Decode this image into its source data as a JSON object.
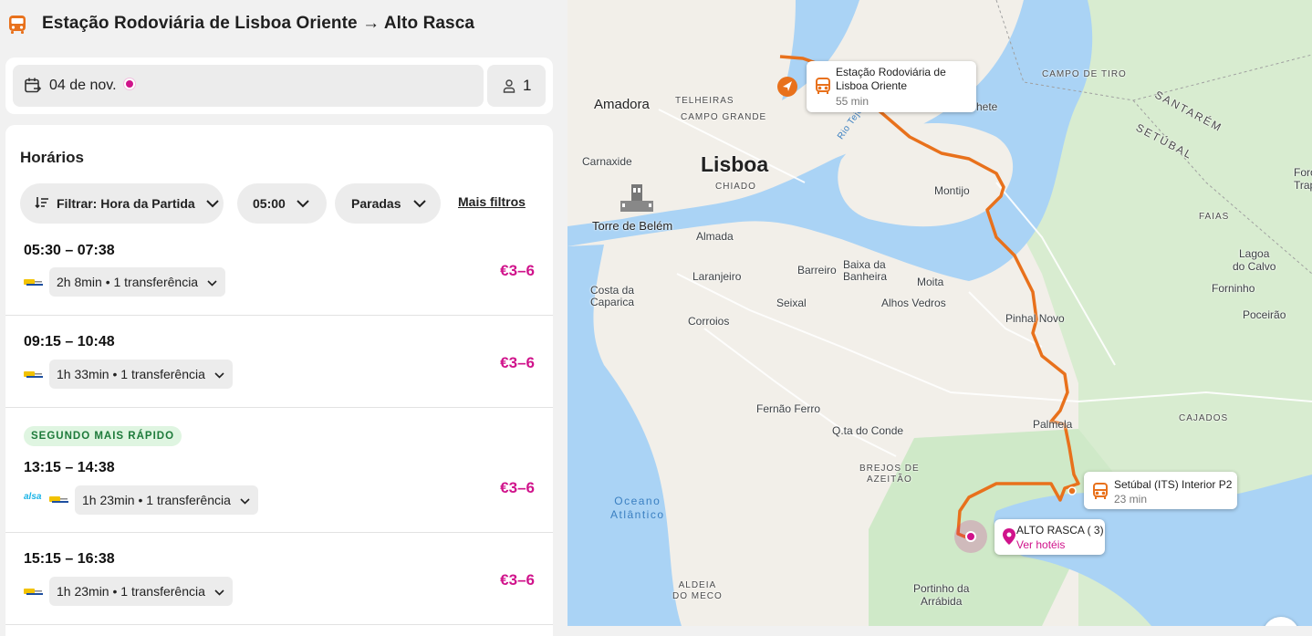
{
  "header": {
    "title": "Estação Rodoviária de Lisboa Oriente → Alto Rasca"
  },
  "search": {
    "date": "04 de nov.",
    "passengers": "1"
  },
  "results": {
    "section_title": "Horários",
    "filters": {
      "sort_label": "Filtrar: Hora da Partida",
      "time_label": "05:00",
      "stops_label": "Paradas",
      "more_label": "Mais filtros"
    },
    "trips": [
      {
        "times": "05:30 – 07:38",
        "duration": "2h 8min • 1 transferência",
        "price": "€3–6",
        "badge": ""
      },
      {
        "times": "09:15 – 10:48",
        "duration": "1h 33min • 1 transferência",
        "price": "€3–6",
        "badge": ""
      },
      {
        "times": "13:15 – 14:38",
        "duration": "1h 23min • 1 transferência",
        "price": "€3–6",
        "badge": "SEGUNDO MAIS RÁPIDO",
        "logo_text": "alsa"
      },
      {
        "times": "15:15 – 16:38",
        "duration": "1h 23min • 1 transferência",
        "price": "€3–6",
        "badge": ""
      }
    ]
  },
  "map": {
    "places": {
      "amadora": "Amadora",
      "telheiras": "TELHEIRAS",
      "campo_grande": "CAMPO GRANDE",
      "carnaxide": "Carnaxide",
      "lisboa": "Lisboa",
      "chiado": "CHIADO",
      "torre_belem": "Torre de Belém",
      "almada": "Almada",
      "laranjeiro": "Laranjeiro",
      "costa_caparica": "Costa da\nCaparica",
      "barreiro": "Barreiro",
      "baixa_banheira": "Baixa da\nBanheira",
      "moita": "Moita",
      "seixal": "Seixal",
      "alhos_vedros": "Alhos Vedros",
      "corroios": "Corroios",
      "montijo": "Montijo",
      "pinhal_novo": "Pinhal Novo",
      "fernao_ferro": "Fernão Ferro",
      "qta_conde": "Q.ta do Conde",
      "palmela": "Palmela",
      "brejos_azeitao": "BREJOS DE\nAZEITÃO",
      "oceano": "Oceano\nAtlântico",
      "aldeia_meco": "ALDEIA\nDO MECO",
      "portinho": "Portinho da\nArrábida",
      "campo_tiro": "CAMPO DE TIRO",
      "santarem": "SANTARÉM",
      "setubal_region": "SETÚBAL",
      "foros": "Foros\nTrap",
      "faias": "FAIAS",
      "lagoa_calvo": "Lagoa\ndo Calvo",
      "forninho": "Forninho",
      "poceirao": "Poceirão",
      "cajados": "CAJADOS",
      "rio_tejo": "Rio Tejo",
      "hete": "hete"
    },
    "origin_callout": {
      "name": "Estação Rodoviária de\nLisboa Oriente",
      "time": "55 min"
    },
    "transfer_callout": {
      "name": "Setúbal (ITS) Interior P2",
      "time": "23 min"
    },
    "destination_callout": {
      "name": "ALTO RASCA ( 3)",
      "link": "Ver hotéis"
    },
    "colors": {
      "route": "#e8711c",
      "water": "#aad3f5",
      "park": "#cfe9c8",
      "accent": "#d0138b"
    }
  }
}
